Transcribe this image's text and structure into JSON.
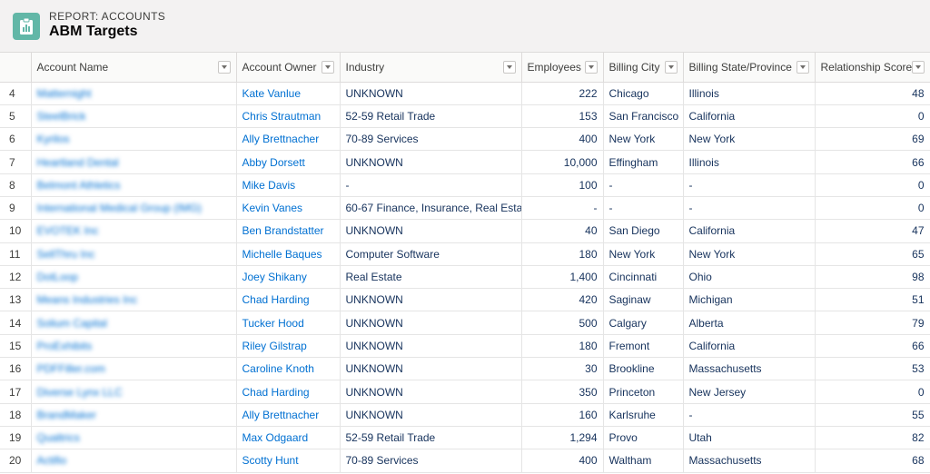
{
  "header": {
    "eyebrow": "REPORT: ACCOUNTS",
    "title": "ABM Targets",
    "icon": "report-icon",
    "accent_color": "#62b7a7"
  },
  "table": {
    "columns": [
      {
        "label": "Account Name"
      },
      {
        "label": "Account Owner"
      },
      {
        "label": "Industry"
      },
      {
        "label": "Employees"
      },
      {
        "label": "Billing City"
      },
      {
        "label": "Billing State/Province"
      },
      {
        "label": "Relationship Score"
      }
    ],
    "rows": [
      {
        "num": "4",
        "name": "Matternight",
        "owner": "Kate Vanlue",
        "industry": "UNKNOWN",
        "employees": "222",
        "city": "Chicago",
        "state": "Illinois",
        "score": "48"
      },
      {
        "num": "5",
        "name": "SteelBrick",
        "owner": "Chris Strautman",
        "industry": "52-59 Retail Trade",
        "employees": "153",
        "city": "San Francisco",
        "state": "California",
        "score": "0"
      },
      {
        "num": "6",
        "name": "Kyrilos",
        "owner": "Ally Brettnacher",
        "industry": "70-89 Services",
        "employees": "400",
        "city": "New York",
        "state": "New York",
        "score": "69"
      },
      {
        "num": "7",
        "name": "Heartland Dental",
        "owner": "Abby Dorsett",
        "industry": "UNKNOWN",
        "employees": "10,000",
        "city": "Effingham",
        "state": "Illinois",
        "score": "66"
      },
      {
        "num": "8",
        "name": "Belmont Athletics",
        "owner": "Mike Davis",
        "industry": "-",
        "employees": "100",
        "city": "-",
        "state": "-",
        "score": "0"
      },
      {
        "num": "9",
        "name": "International Medical Group (IMG)",
        "owner": "Kevin Vanes",
        "industry": "60-67 Finance, Insurance, Real Estate",
        "employees": "-",
        "city": "-",
        "state": "-",
        "score": "0"
      },
      {
        "num": "10",
        "name": "EVOTEK Inc",
        "owner": "Ben Brandstatter",
        "industry": "UNKNOWN",
        "employees": "40",
        "city": "San Diego",
        "state": "California",
        "score": "47"
      },
      {
        "num": "11",
        "name": "SellThru Inc",
        "owner": "Michelle Baques",
        "industry": "Computer Software",
        "employees": "180",
        "city": "New York",
        "state": "New York",
        "score": "65"
      },
      {
        "num": "12",
        "name": "DotLoop",
        "owner": "Joey Shikany",
        "industry": "Real Estate",
        "employees": "1,400",
        "city": "Cincinnati",
        "state": "Ohio",
        "score": "98"
      },
      {
        "num": "13",
        "name": "Means Industries Inc",
        "owner": "Chad Harding",
        "industry": "UNKNOWN",
        "employees": "420",
        "city": "Saginaw",
        "state": "Michigan",
        "score": "51"
      },
      {
        "num": "14",
        "name": "Solium Capital",
        "owner": "Tucker Hood",
        "industry": "UNKNOWN",
        "employees": "500",
        "city": "Calgary",
        "state": "Alberta",
        "score": "79"
      },
      {
        "num": "15",
        "name": "ProExhibits",
        "owner": "Riley Gilstrap",
        "industry": "UNKNOWN",
        "employees": "180",
        "city": "Fremont",
        "state": "California",
        "score": "66"
      },
      {
        "num": "16",
        "name": "PDFFiller.com",
        "owner": "Caroline Knoth",
        "industry": "UNKNOWN",
        "employees": "30",
        "city": "Brookline",
        "state": "Massachusetts",
        "score": "53"
      },
      {
        "num": "17",
        "name": "Diverse Lynx LLC",
        "owner": "Chad Harding",
        "industry": "UNKNOWN",
        "employees": "350",
        "city": "Princeton",
        "state": "New Jersey",
        "score": "0"
      },
      {
        "num": "18",
        "name": "BrandMaker",
        "owner": "Ally Brettnacher",
        "industry": "UNKNOWN",
        "employees": "160",
        "city": "Karlsruhe",
        "state": "-",
        "score": "55"
      },
      {
        "num": "19",
        "name": "Qualtrics",
        "owner": "Max Odgaard",
        "industry": "52-59 Retail Trade",
        "employees": "1,294",
        "city": "Provo",
        "state": "Utah",
        "score": "82"
      },
      {
        "num": "20",
        "name": "Actifio",
        "owner": "Scotty Hunt",
        "industry": "70-89 Services",
        "employees": "400",
        "city": "Waltham",
        "state": "Massachusetts",
        "score": "68"
      }
    ]
  }
}
